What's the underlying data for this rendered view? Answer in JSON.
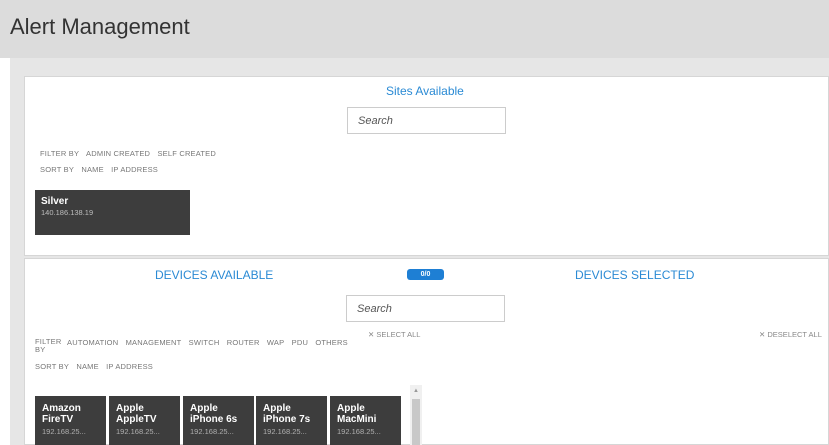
{
  "page": {
    "title": "Alert Management"
  },
  "sites": {
    "title": "Sites Available",
    "search_placeholder": "Search",
    "filter": {
      "label": "FILTER BY",
      "options": [
        "ADMIN CREATED",
        "SELF CREATED"
      ]
    },
    "sort": {
      "label": "SORT BY",
      "options": [
        "NAME",
        "IP ADDRESS"
      ]
    },
    "items": [
      {
        "name": "Silver",
        "ip": "140.186.138.19"
      }
    ]
  },
  "devices": {
    "available_title": "DEVICES AVAILABLE",
    "selected_title": "DEVICES SELECTED",
    "count_badge": "0/0",
    "search_placeholder": "Search",
    "select_all": "SELECT ALL",
    "deselect_all": "DESELECT ALL",
    "filter": {
      "label_line1": "FILTER",
      "label_line2": "BY",
      "options": [
        "AUTOMATION",
        "MANAGEMENT",
        "SWITCH",
        "ROUTER",
        "WAP",
        "PDU",
        "OTHERS"
      ]
    },
    "sort": {
      "label": "SORT BY",
      "options": [
        "NAME",
        "IP ADDRESS"
      ]
    },
    "items": [
      {
        "line1": "Amazon",
        "line2": "FireTV",
        "ip": "192.168.25..."
      },
      {
        "line1": "Apple",
        "line2": "AppleTV",
        "ip": "192.168.25..."
      },
      {
        "line1": "Apple",
        "line2": "iPhone 6s",
        "ip": "192.168.25..."
      },
      {
        "line1": "Apple",
        "line2": "iPhone 7s",
        "ip": "192.168.25..."
      },
      {
        "line1": "Apple",
        "line2": "MacMini",
        "ip": "192.168.25..."
      }
    ]
  },
  "icons": {
    "close": "close-icon",
    "scroll_up": "chevron-up-icon"
  },
  "colors": {
    "accent": "#2a8ad4",
    "badge": "#1e7fd4",
    "card": "#3d3d3d",
    "header": "#dcdcdc"
  }
}
